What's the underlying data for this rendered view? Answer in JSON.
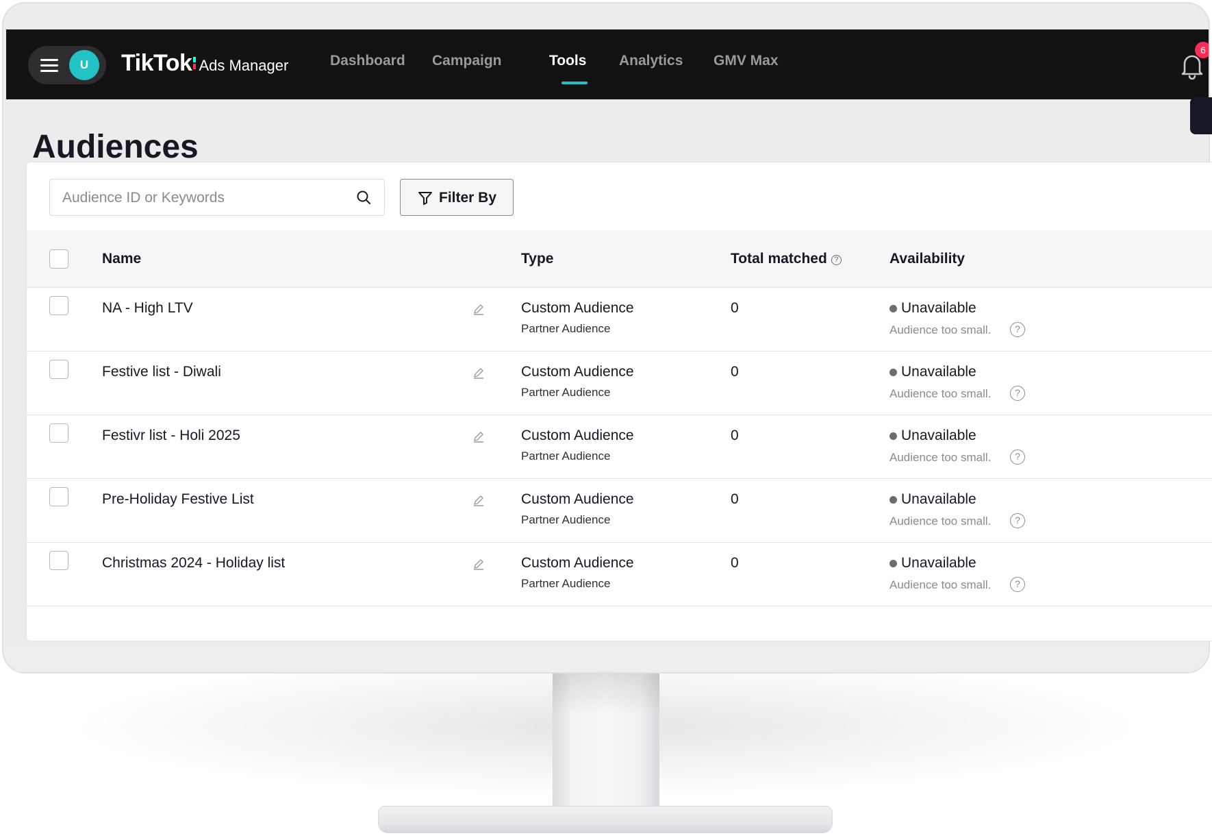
{
  "nav": {
    "avatar_initial": "U",
    "brand": "TikTok",
    "product": "Ads Manager",
    "items": [
      {
        "label": "Dashboard",
        "active": false
      },
      {
        "label": "Campaign",
        "active": false
      },
      {
        "label": "Tools",
        "active": true
      },
      {
        "label": "Analytics",
        "active": false
      },
      {
        "label": "GMV Max",
        "active": false
      }
    ],
    "notification_count": "6",
    "accent_color": "#22c3c5"
  },
  "page": {
    "title": "Audiences"
  },
  "toolbar": {
    "search_placeholder": "Audience ID or Keywords",
    "filter_label": "Filter By"
  },
  "table": {
    "columns": {
      "name": "Name",
      "type": "Type",
      "total_matched": "Total matched",
      "availability": "Availability"
    },
    "rows": [
      {
        "name": "NA - High LTV",
        "type": "Custom Audience",
        "subtype": "Partner Audience",
        "matched": "0",
        "availability": "Unavailable",
        "reason": "Audience too small."
      },
      {
        "name": "Festive list - Diwali",
        "type": "Custom Audience",
        "subtype": "Partner Audience",
        "matched": "0",
        "availability": "Unavailable",
        "reason": "Audience too small."
      },
      {
        "name": "Festivr list - Holi 2025",
        "type": "Custom Audience",
        "subtype": "Partner Audience",
        "matched": "0",
        "availability": "Unavailable",
        "reason": "Audience too small."
      },
      {
        "name": "Pre-Holiday Festive List",
        "type": "Custom Audience",
        "subtype": "Partner Audience",
        "matched": "0",
        "availability": "Unavailable",
        "reason": "Audience too small."
      },
      {
        "name": "Christmas 2024 - Holiday list",
        "type": "Custom Audience",
        "subtype": "Partner Audience",
        "matched": "0",
        "availability": "Unavailable",
        "reason": "Audience too small."
      }
    ]
  }
}
